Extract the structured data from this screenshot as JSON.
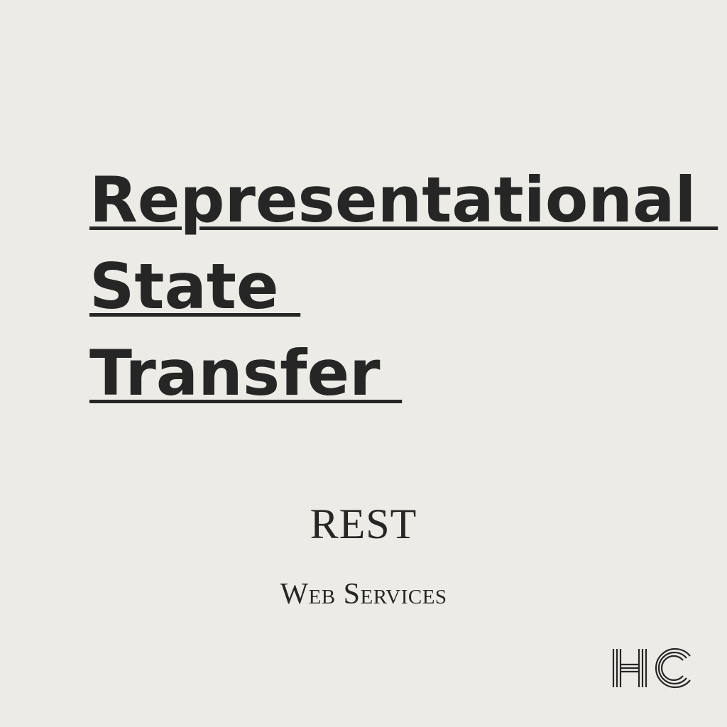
{
  "title": {
    "lines": [
      "Representational ",
      "State ",
      "Transfer "
    ]
  },
  "acronym": "REST",
  "subtitle": "Web Services",
  "logo": {
    "text": "HC",
    "icon": "hc-logo-icon"
  },
  "colors": {
    "background": "#edebe6",
    "text": "#262626"
  }
}
